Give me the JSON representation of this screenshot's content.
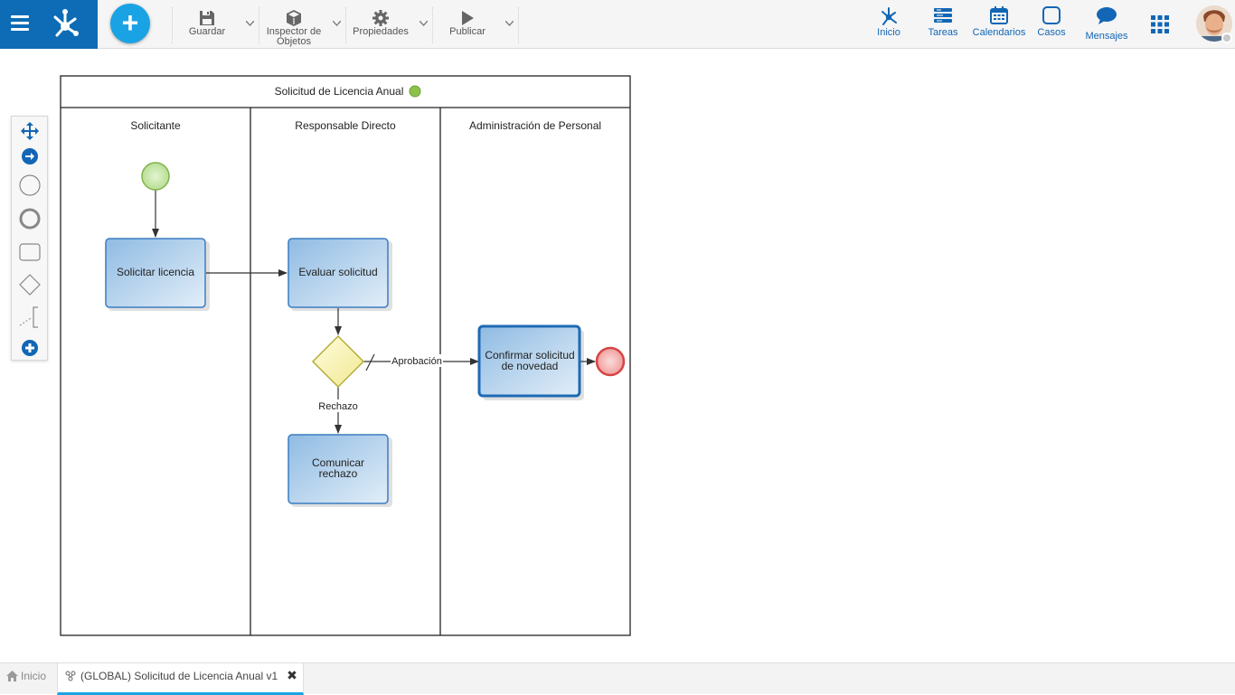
{
  "toolbar": {
    "guardar": "Guardar",
    "inspector_line1": "Inspector de",
    "inspector_line2": "Objetos",
    "propiedades": "Propiedades",
    "publicar": "Publicar"
  },
  "nav": {
    "inicio": "Inicio",
    "tareas": "Tareas",
    "calendarios": "Calendarios",
    "casos": "Casos",
    "mensajes": "Mensajes"
  },
  "icons": {
    "menu": "hamburger-icon",
    "logo": "process-hub-logo",
    "add": "plus-icon",
    "guardar": "floppy-disk-icon",
    "inspector": "cube-icon",
    "propiedades": "gear-icon",
    "publicar": "play-icon",
    "apps": "grid-icon"
  },
  "colors": {
    "brand": "#0d6cb5",
    "accent": "#1aa3e4",
    "nav_text": "#1266b5",
    "task_fill": "#a9cbe8",
    "task_border": "#3a7dc2",
    "start_event": "#c7e6a8",
    "end_event": "#f4b6b6",
    "gateway": "#f5f0b0",
    "pool_status": "#8bc34a"
  },
  "diagram": {
    "pool_title": "Solicitud de Licencia Anual",
    "lanes": [
      "Solicitante",
      "Responsable Directo",
      "Administración de Personal"
    ],
    "tasks": {
      "solicitar": "Solicitar licencia",
      "evaluar": "Evaluar solicitud",
      "comunicar_1": "Comunicar",
      "comunicar_2": "rechazo",
      "confirmar_1": "Confirmar solicitud",
      "confirmar_2": "de novedad"
    },
    "flow_labels": {
      "aprobacion": "Aprobación",
      "rechazo": "Rechazo"
    }
  },
  "tabs": {
    "home": "Inicio",
    "active": "(GLOBAL) Solicitud de Licencia Anual v1",
    "close": "✖"
  }
}
